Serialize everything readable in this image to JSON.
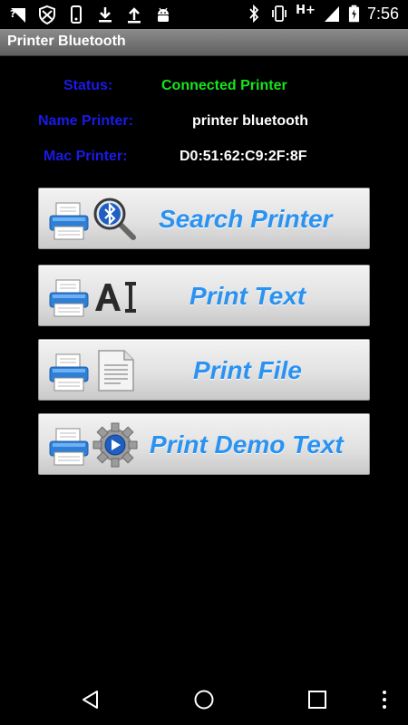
{
  "statusbar": {
    "left_icons": [
      "wifi-unknown-icon",
      "shield-icon",
      "phone-icon",
      "download-icon",
      "upload-icon",
      "android-icon"
    ],
    "right_icons": [
      "bluetooth-icon",
      "vibrate-icon",
      "hplus-signal-icon",
      "signal-icon",
      "battery-icon"
    ],
    "network": "H+",
    "time": "7:56"
  },
  "titlebar": {
    "title": "Printer Bluetooth"
  },
  "info": {
    "status_label": "Status:",
    "status_value": "Connected Printer",
    "name_label": "Name Printer:",
    "name_value": "printer bluetooth",
    "mac_label": "Mac Printer:",
    "mac_value": "D0:51:62:C9:2F:8F"
  },
  "buttons": {
    "search": {
      "label": "Search Printer",
      "icons": [
        "printer-icon",
        "bluetooth-search-icon"
      ]
    },
    "print_text": {
      "label": "Print Text",
      "icons": [
        "printer-icon",
        "text-ai-icon"
      ]
    },
    "print_file": {
      "label": "Print File",
      "icons": [
        "printer-icon",
        "document-icon"
      ]
    },
    "print_demo": {
      "label": "Print Demo Text",
      "icons": [
        "printer-icon",
        "gear-play-icon"
      ]
    }
  },
  "colors": {
    "label_blue": "#1a1ae8",
    "status_green": "#16e61c",
    "button_text": "#2a92f0",
    "background": "#000000"
  },
  "navbar": {
    "buttons": [
      "back-icon",
      "home-icon",
      "recents-icon",
      "overflow-menu-icon"
    ]
  }
}
